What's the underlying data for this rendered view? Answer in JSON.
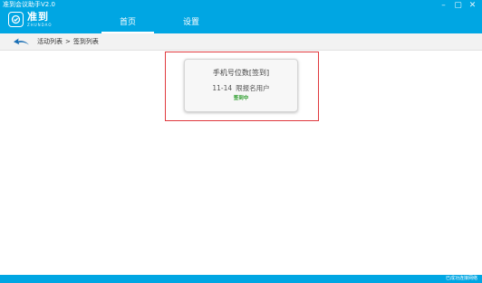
{
  "window": {
    "title": "准到会议助手V2.0",
    "controls": [
      "–",
      "▢",
      "✕"
    ]
  },
  "logo": {
    "name_cn": "准到",
    "name_en": "ZHUNDAO"
  },
  "nav": {
    "tabs": [
      {
        "label": "首页",
        "active": true
      },
      {
        "label": "设置",
        "active": false
      }
    ]
  },
  "breadcrumb": {
    "items": [
      "活动列表",
      ">",
      "签到列表"
    ]
  },
  "card": {
    "title": "手机号位数[签到]",
    "date": "11-14",
    "subtitle": "限报名用户",
    "status": "签到中",
    "status_color": "#2b9c2b"
  },
  "footer": {
    "status": "已成功连接网络"
  },
  "colors": {
    "primary": "#00a6e3",
    "highlight": "#e0393e"
  }
}
